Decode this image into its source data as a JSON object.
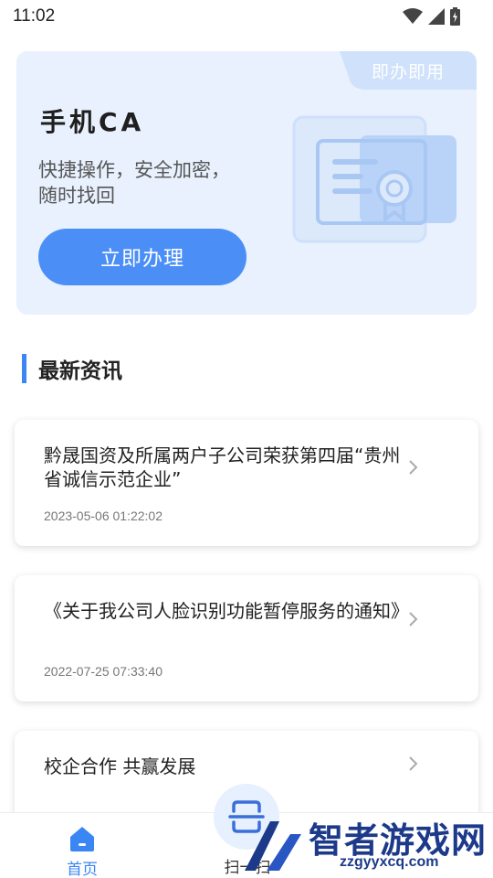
{
  "status_bar": {
    "time": "11:02"
  },
  "ca_card": {
    "tag": "即办即用",
    "title": "手机CA",
    "description": "快捷操作，安全加密，随时找回",
    "button_label": "立即办理"
  },
  "news_section": {
    "title": "最新资讯"
  },
  "news": [
    {
      "title": "黔晟国资及所属两户子公司荣获第四届“贵州省诚信示范企业”",
      "date": "2023-05-06 01:22:02"
    },
    {
      "title": "《关于我公司人脸识别功能暂停服务的通知》",
      "date": "2022-07-25 07:33:40"
    },
    {
      "title": "校企合作 共赢发展",
      "date": ""
    }
  ],
  "bottom_nav": {
    "home_label": "首页",
    "scan_label": "扫一扫"
  },
  "watermark": {
    "text": "智者游戏网",
    "url": "zzgyyxcq.com"
  },
  "colors": {
    "accent": "#3a86f5",
    "card_bg": "#e8f1fd",
    "button": "#4b8ff6"
  }
}
